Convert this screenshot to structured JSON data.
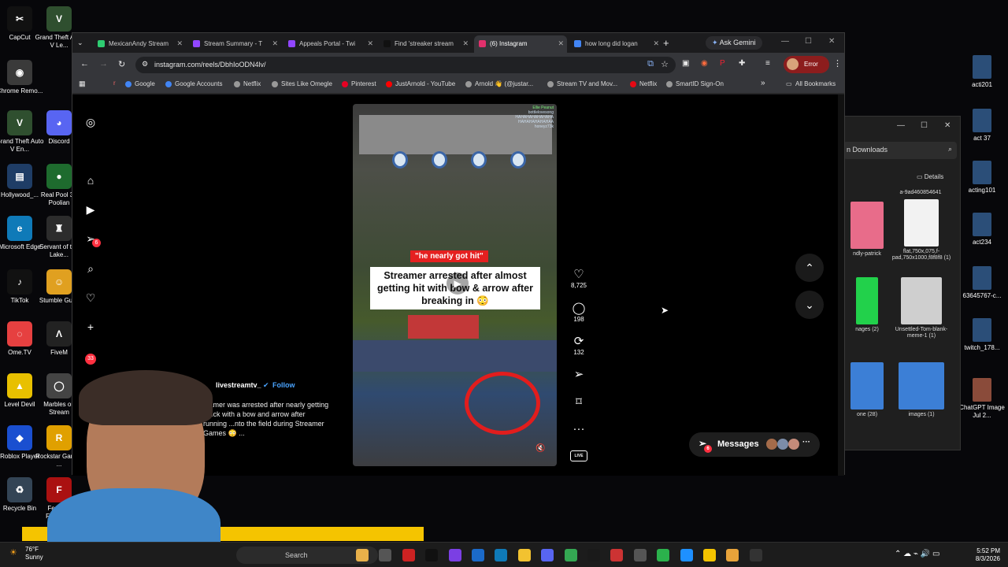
{
  "desktop_left": [
    {
      "label": "CapCut",
      "color": "#111111",
      "glyph": "✂"
    },
    {
      "label": "Grand Theft Auto V Le...",
      "color": "#2f4f2f",
      "glyph": "V"
    },
    {
      "label": "Chrome Remo...",
      "color": "#3a3a3a",
      "glyph": "◉"
    },
    {
      "label": "Discord",
      "color": "#5865f2",
      "glyph": "◕"
    },
    {
      "label": "Grand Theft Auto V En...",
      "color": "#2f4f2f",
      "glyph": "V"
    },
    {
      "label": "Hollywood_...",
      "color": "#1f3d66",
      "glyph": "▤"
    },
    {
      "label": "Real Pool 3 - Poolian",
      "color": "#1e6b2e",
      "glyph": "●"
    },
    {
      "label": "Microsoft Edge",
      "color": "#0f7ab8",
      "glyph": "e"
    },
    {
      "label": "Servant of the Lake...",
      "color": "#2c2c2c",
      "glyph": "♜"
    },
    {
      "label": "TikTok",
      "color": "#111111",
      "glyph": "♪"
    },
    {
      "label": "Stumble Guys",
      "color": "#e0a020",
      "glyph": "☺"
    },
    {
      "label": "Ome.TV",
      "color": "#e64040",
      "glyph": "◌"
    },
    {
      "label": "FiveM",
      "color": "#222222",
      "glyph": "Λ"
    },
    {
      "label": "Level Devil",
      "color": "#e8c000",
      "glyph": "▲"
    },
    {
      "label": "Marbles on Stream",
      "color": "#444444",
      "glyph": "◯"
    },
    {
      "label": "Roblox Player",
      "color": "#1a4fd0",
      "glyph": "◆"
    },
    {
      "label": "Rockstar Games ...",
      "color": "#e0a000",
      "glyph": "R"
    },
    {
      "label": "Recycle Bin",
      "color": "#334455",
      "glyph": "♻"
    },
    {
      "label": "Fears to Fathom...",
      "color": "#aa1111",
      "glyph": "F"
    }
  ],
  "desktop_right": [
    "acti201",
    "act 37",
    "acting101",
    "act234",
    "63645767-c...",
    "twitch_178...",
    "ChatGPT Image Jul 2..."
  ],
  "explorer": {
    "search_label": "n Downloads",
    "details_label": "Details",
    "items": [
      "a-9ad460854641",
      "ndly-patrick",
      "flat,750x,075,f-pad,750x1000,f8f8f8 (1)",
      "nages (2)",
      "Unsettled-Tom-blank-meme-1 (1)",
      "one (28)",
      "images (1)"
    ]
  },
  "browser": {
    "tabs": [
      {
        "title": "MexicanAndy Stream",
        "color": "#2ecc71"
      },
      {
        "title": "Stream Summary - T",
        "color": "#9146ff"
      },
      {
        "title": "Appeals Portal - Twi",
        "color": "#9146ff"
      },
      {
        "title": "Find 'streaker stream",
        "color": "#111111"
      },
      {
        "title": "(6) Instagram",
        "color": "#e1306c"
      },
      {
        "title": "how long did logan",
        "color": "#4285f4"
      }
    ],
    "ask_gemini": "Ask Gemini",
    "url": "instagram.com/reels/DbhIoODN4lv/",
    "error_label": "Error",
    "bookmarks": [
      {
        "label": "Google",
        "color": "#4285f4"
      },
      {
        "label": "Google Accounts",
        "color": "#4285f4"
      },
      {
        "label": "Netflix",
        "color": "#999999"
      },
      {
        "label": "Sites Like Omegle",
        "color": "#999999"
      },
      {
        "label": "Pinterest",
        "color": "#e60023"
      },
      {
        "label": "JustArnold - YouTube",
        "color": "#ff0000"
      },
      {
        "label": "Arnold 👋 (@justar...",
        "color": "#999999"
      },
      {
        "label": "Stream TV and Mov...",
        "color": "#999999"
      },
      {
        "label": "Netflix",
        "color": "#e50914"
      },
      {
        "label": "SmartID Sign-On",
        "color": "#999999"
      }
    ],
    "all_bookmarks": "All Bookmarks"
  },
  "instagram": {
    "notification_badge": "6",
    "activity_badge": "33",
    "video": {
      "top_caption": "\"he nearly got hit\"",
      "headline": "Streamer arrested after almost getting hit with bow & arrow after breaking in 😳",
      "comments_overlay": [
        "Ellie Peanut",
        "bottlelovesong",
        "HAHAHAHAHAHAHA",
        "HAHAHAHAHAHAA",
        "honeyz73k"
      ]
    },
    "author": "livestreamtv_",
    "follow_label": "Follow",
    "caption": "...amer was arrested after nearly getting ...uck with a bow and arrow after running ...nto the field during Streamer Games 😳 ...",
    "likes": "8,725",
    "comments": "198",
    "reposts": "132",
    "messages_label": "Messages",
    "messages_badge": "6",
    "live_label": "LIVE"
  },
  "taskbar": {
    "weather_temp": "76°F",
    "weather_desc": "Sunny",
    "search_placeholder": "Search",
    "time": "5:52 PM",
    "date": "8/3/2026",
    "chat_badge": "99+"
  }
}
